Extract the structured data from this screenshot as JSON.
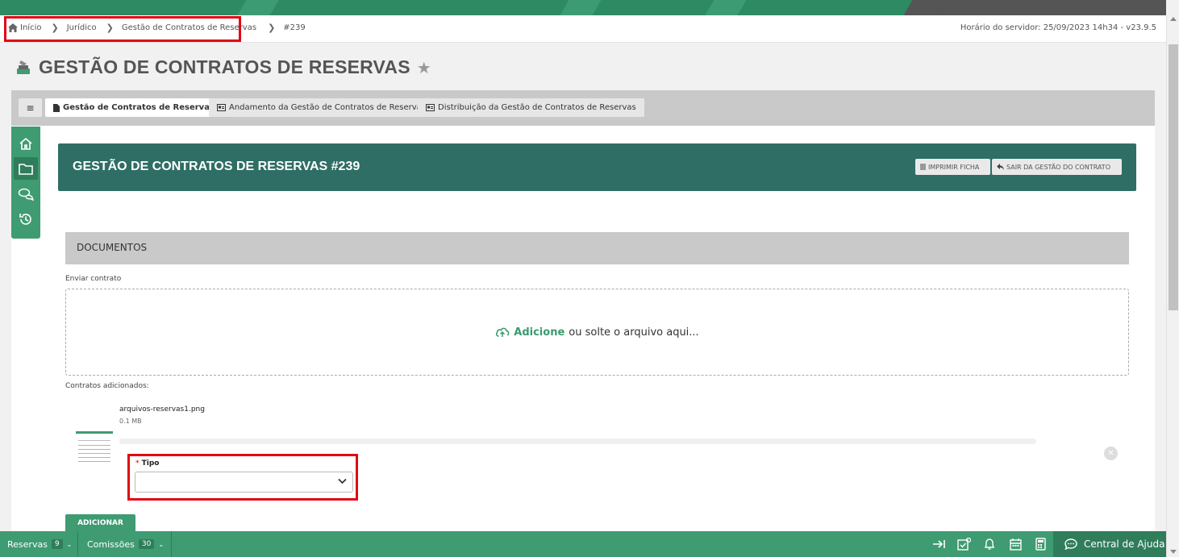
{
  "breadcrumb": {
    "items": [
      "Início",
      "Jurídico",
      "Gestão de Contratos de Reservas",
      "#239"
    ],
    "server_time": "Horário do servidor: 25/09/2023 14h34 - v23.9.5"
  },
  "page": {
    "title": "GESTÃO DE CONTRATOS DE RESERVAS"
  },
  "tabs": [
    {
      "label": "Gestão de Contratos de Reservas",
      "icon": "document-icon",
      "active": true
    },
    {
      "label": "Andamento da Gestão de Contratos de Reservas",
      "icon": "id-card-icon",
      "active": false
    },
    {
      "label": "Distribuição da Gestão de Contratos de Reservas",
      "icon": "id-card-icon",
      "active": false
    }
  ],
  "sidebar": {
    "items": [
      "home-icon",
      "folder-icon",
      "chat-icon",
      "history-icon"
    ]
  },
  "header": {
    "title": "GESTÃO DE CONTRATOS DE RESERVAS #239",
    "print_label": "IMPRIMIR FICHA",
    "exit_label": "SAIR DA GESTÃO DO CONTRATO"
  },
  "documents": {
    "section_title": "DOCUMENTOS",
    "upload_label": "Enviar contrato",
    "dropzone_link": "Adicione",
    "dropzone_text": "ou solte o arquivo aqui...",
    "added_label": "Contratos adicionados:",
    "file": {
      "name": "arquivos-reservas1.png",
      "size": "0.1 MB"
    },
    "tipo_label": "Tipo",
    "tipo_required": "*",
    "tipo_value": "",
    "add_button": "ADICIONAR"
  },
  "bottombar": {
    "reservas_label": "Reservas",
    "reservas_count": "9",
    "comissoes_label": "Comissões",
    "comissoes_count": "30",
    "help_label": "Central de Ajuda"
  },
  "colors": {
    "brand_green": "#3f9b72",
    "header_teal": "#2e6e65",
    "highlight_red": "#e30613"
  }
}
